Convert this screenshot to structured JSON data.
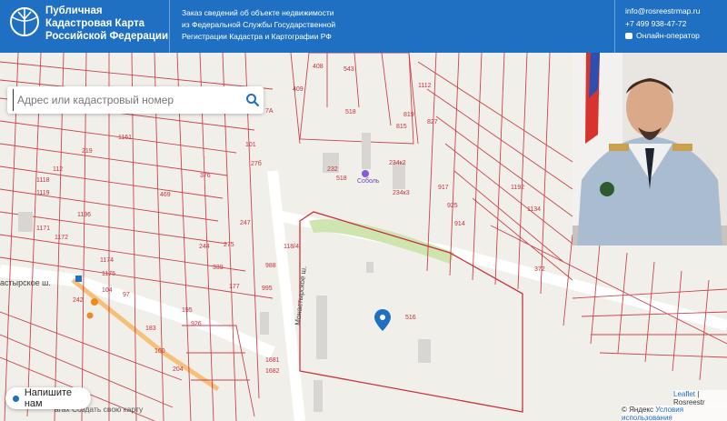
{
  "header": {
    "brand_line1": "Публичная",
    "brand_line2": "Кадастровая Карта",
    "brand_line3": "Российской Федерации",
    "info_line1": "Заказ сведений об объекте недвижимости",
    "info_line2": "из Федеральной Службы Государственной",
    "info_line3": "Регистрации Кадастра и Картографии РФ",
    "email": "info@rosreestrmap.ru",
    "phone": "+7 499 938-47-72",
    "online": "Онлайн-оператор"
  },
  "search": {
    "placeholder": "Адрес или кадастровый номер"
  },
  "map": {
    "street1": "Монастырское ш.",
    "street2": "астырское ш.",
    "poi": "Соболь",
    "parcels": [
      "408",
      "543",
      "518",
      "409",
      "7А",
      "232",
      "518",
      "234к2",
      "234к3",
      "101",
      "27б",
      "376",
      "469",
      "247",
      "244",
      "339",
      "275",
      "177",
      "995",
      "988",
      "118/4",
      "516",
      "1681",
      "1682",
      "372",
      "242",
      "104",
      "97",
      "195",
      "183",
      "160",
      "204",
      "219",
      "1118",
      "1119",
      "112",
      "1174",
      "1175",
      "1171",
      "1172",
      "1196",
      "1161",
      "926",
      "917",
      "925",
      "914",
      "827",
      "819",
      "815",
      "1112",
      "1134",
      "1192"
    ]
  },
  "chat": {
    "label": "Напишите нам"
  },
  "under_text": "агах    Создать свою карту",
  "attribution": {
    "leaflet": "Leaflet",
    "rosreestr": "| Rosreestr",
    "yandex": "© Яндекс",
    "terms": "Условия использования"
  },
  "colors": {
    "header": "#1f6fc2",
    "parcel_line": "#c8323c",
    "map_bg": "#f1efea",
    "green": "#cfe5b0"
  }
}
